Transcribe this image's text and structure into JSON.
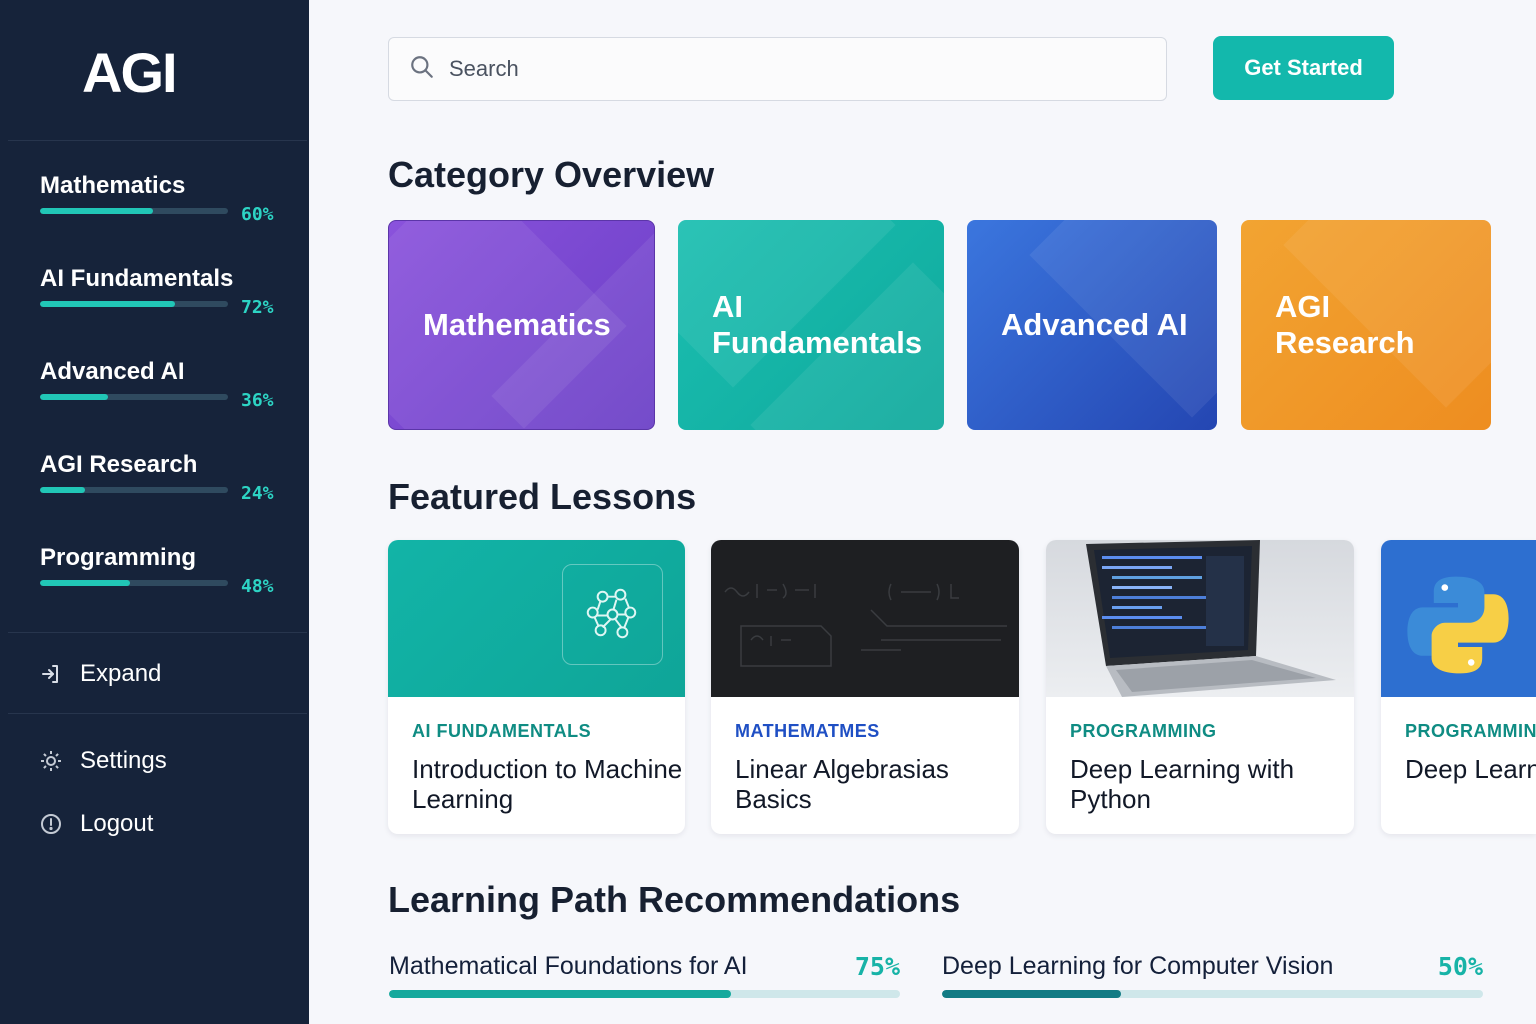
{
  "sidebar": {
    "logo": "AGI",
    "categories": [
      {
        "label": "Mathematics",
        "progress": 60,
        "progress_text": "60%"
      },
      {
        "label": "AI Fundamentals",
        "progress": 72,
        "progress_text": "72%"
      },
      {
        "label": "Advanced AI",
        "progress": 36,
        "progress_text": "36%"
      },
      {
        "label": "AGI Research",
        "progress": 24,
        "progress_text": "24%"
      },
      {
        "label": "Programming",
        "progress": 48,
        "progress_text": "48%"
      }
    ],
    "expand_label": "Expand",
    "settings_label": "Settings",
    "logout_label": "Logout",
    "icons": {
      "expand": "expand-icon",
      "settings": "gear-icon",
      "logout": "logout-icon"
    }
  },
  "header": {
    "search_placeholder": "Search",
    "cta_label": "Get Started",
    "search_icon": "search-icon"
  },
  "category_overview": {
    "title": "Category Overview",
    "cards": [
      {
        "label": "Mathematics",
        "color": "#7b4dd6"
      },
      {
        "label": "AI Fundamentals",
        "color": "#17b6a9"
      },
      {
        "label": "Advanced AI",
        "color": "#2f62cf"
      },
      {
        "label": "AGI Research",
        "color": "#f09a2a"
      }
    ]
  },
  "featured_lessons": {
    "title": "Featured Lessons",
    "lessons": [
      {
        "tag": "AI FUNDAMENTALS",
        "title": "Introduction to Machine Learning",
        "tag_color": "#0f8c83",
        "thumb": "brain-network-icon"
      },
      {
        "tag": "MATHEMATMES",
        "title": "Linear Algebrasias Basics",
        "tag_color": "#1f4fc4",
        "thumb": "chalkboard-equations"
      },
      {
        "tag": "PROGRAMMING",
        "title": "Deep Learning with Python",
        "tag_color": "#0f8c83",
        "thumb": "laptop-code"
      },
      {
        "tag": "PROGRAMMIN",
        "title": "Deep Learn Techniqued",
        "tag_color": "#0f8c83",
        "thumb": "python-logo-icon"
      }
    ]
  },
  "learning_paths": {
    "title": "Learning Path Recommendations",
    "paths": [
      {
        "label": "Mathematical Foundations for AI",
        "progress": 67,
        "progress_text": "75%",
        "color": "#15a99d"
      },
      {
        "label": "Deep Learning for Computer Vision",
        "progress": 33,
        "progress_text": "50%",
        "color": "#127b84"
      }
    ]
  },
  "colors": {
    "sidebar_bg": "#16233a",
    "accent": "#13b8ac",
    "page_bg": "#f6f7fb"
  }
}
